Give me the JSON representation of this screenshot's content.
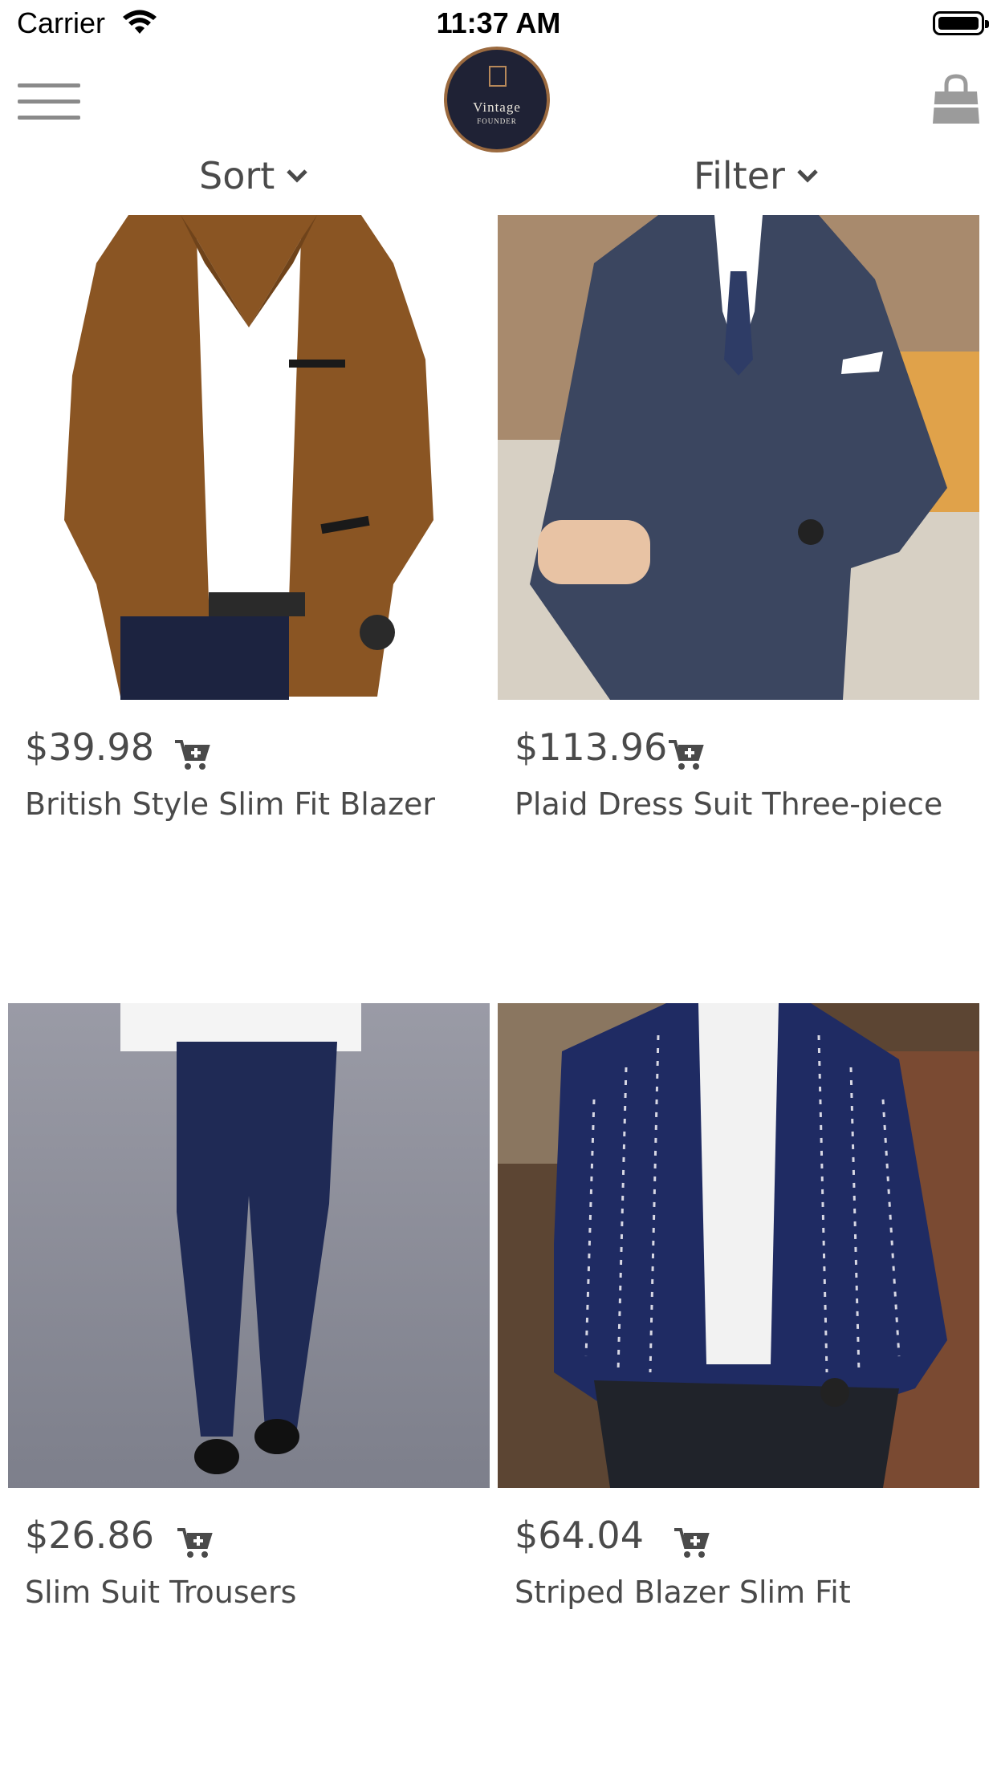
{
  "status_bar": {
    "carrier": "Carrier",
    "time": "11:37 AM"
  },
  "logo": {
    "title": "Vintage",
    "subtitle": "FOUNDER"
  },
  "toolbar": {
    "sort_label": "Sort",
    "filter_label": "Filter"
  },
  "icons": {
    "menu": "hamburger-icon",
    "cart": "shopping-bag-icon",
    "add_to_cart": "cart-plus-icon",
    "chevron": "chevron-down-icon"
  },
  "products": [
    {
      "price": "$39.98",
      "name": "British Style Slim Fit Blazer"
    },
    {
      "price": "$113.96",
      "name": "Plaid Dress Suit Three-piece"
    },
    {
      "price": "$26.86",
      "name": "Slim Suit Trousers"
    },
    {
      "price": "$64.04",
      "name": "Striped Blazer Slim Fit"
    }
  ],
  "colors": {
    "text": "#4a4a4a",
    "icon": "#4a4a4a",
    "logo_bg": "#1f2235",
    "logo_ring": "#9b6a3f"
  }
}
